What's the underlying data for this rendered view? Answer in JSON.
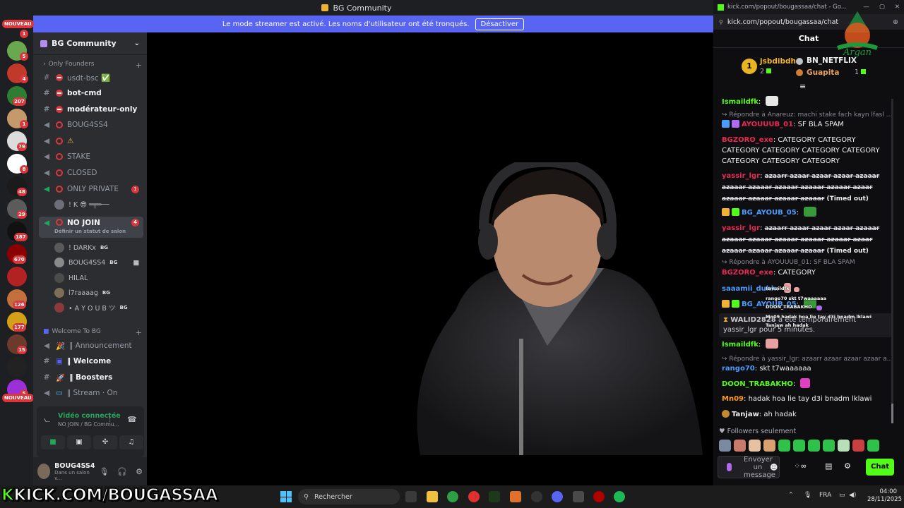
{
  "window_title": "BG Community",
  "banner": {
    "text": "Le mode streamer est activé. Les noms d'utilisateur ont été tronqués.",
    "button": "Désactiver"
  },
  "rail": {
    "new_top": "NOUVEAU",
    "new_bottom": "NOUVEAU",
    "badges": [
      "1",
      "5",
      "4",
      "207",
      "1",
      "79",
      "8",
      "48",
      "29",
      "187",
      "670",
      "126",
      "177",
      "15",
      "5"
    ]
  },
  "guild": {
    "name": "BG Community"
  },
  "categories": {
    "founders": "Only Founders",
    "welcome": "Welcome To BG"
  },
  "channels": [
    {
      "label": "usdt-bsc ✅"
    },
    {
      "label": "bot-cmd"
    },
    {
      "label": "modérateur-only"
    },
    {
      "label": "BOUG4SS4"
    },
    {
      "label": "⚠"
    },
    {
      "label": "STAKE"
    },
    {
      "label": "CLOSED"
    },
    {
      "label": "ONLY PRIVATE",
      "badge": "1"
    },
    {
      "label": "! K 😎 ═╤═──"
    },
    {
      "label": "NO JOIN",
      "badge": "4",
      "sub": "Définir un statut de salon"
    }
  ],
  "members": [
    {
      "name": "! DARKx",
      "tag": "BG"
    },
    {
      "name": "BOUG4SS4",
      "tag": "BG"
    },
    {
      "name": "HILAL",
      "tag": ""
    },
    {
      "name": "l7raaaag",
      "tag": "BG"
    },
    {
      "name": "• A Y O U B ツ",
      "tag": "BG"
    }
  ],
  "welcome_channels": [
    {
      "label": "‖ Announcement"
    },
    {
      "label": "‖ Welcome"
    },
    {
      "label": "‖ Boosters"
    },
    {
      "label": "‖ Stream · On"
    }
  ],
  "voice": {
    "status": "Vidéo connectée",
    "location": "NO JOIN / BG Commu..."
  },
  "user": {
    "name": "BOUG4SS4",
    "status": "Dans un salon v..."
  },
  "chat": {
    "window_title": "kick.com/popout/bougassaa/chat - Go...",
    "url": "kick.com/popout/bougassaa/chat",
    "header": "Chat",
    "leaderboard": [
      {
        "rank": "1",
        "name": "jsbdibdh",
        "count": "2"
      },
      {
        "rank": "",
        "name": "BN_NETFLIX",
        "count": ""
      },
      {
        "rank": "",
        "name": "Guapita",
        "count": "1"
      }
    ],
    "messages": [
      {
        "user": "Ismaildfk",
        "text": "",
        "color": "#53fc18"
      },
      {
        "reply": "Répondre à Anareuz: machi stake fach kayn lfasl ..."
      },
      {
        "user": "AYOUUUB_01",
        "text": "SF BLA SPAM",
        "color": "#e62a54"
      },
      {
        "user": "BGZORO_exe",
        "text": "CATEGORY CATEGORY CATEGORY CATEGORY CATEGORY CATEGORY CATEGORY CATEGORY CATEGORY",
        "color": "#e62a54"
      },
      {
        "user": "yassir_lgr",
        "text": "azaarr azaar azaar azaar azaaar azaaar azaaar azaaar azaaar azaaar azaar azaaar azaaar azaaar azaaar",
        "suffix": "(Timed out)",
        "color": "#e62a54"
      },
      {
        "user": "BG_AYOUB_05",
        "text": "",
        "color": "#4b9cff"
      },
      {
        "user": "yassir_lgr",
        "text": "azaarr azaar azaar azaar azaaar azaaar azaaar azaaar azaaar azaaar azaar azaaar azaaar azaaar azaaar",
        "suffix": "(Timed out)",
        "color": "#e62a54"
      },
      {
        "reply": "Répondre à AYOUUUB_01: SF BLA SPAM"
      },
      {
        "user": "BGZORO_exe",
        "text": "CATEGORY",
        "color": "#e62a54"
      },
      {
        "user": "saaamii_duhh",
        "text": "",
        "color": "#4b9cff"
      },
      {
        "user": "BG_AYOUB_05",
        "text": "",
        "color": "#4b9cff"
      },
      {
        "timeout_user": "WALID2828",
        "timeout_text": "a été temporairement yassir_lgr pour 5 minutes."
      },
      {
        "user": "Ismaildfk",
        "text": "",
        "color": "#53fc18"
      },
      {
        "reply": "Répondre à yassir_lgr: azaarr azaar azaar azaar a..."
      },
      {
        "user": "rango70",
        "text": "skt t7waaaaaa",
        "color": "#4b9cff"
      },
      {
        "user": "DOON_TRABAKHO",
        "text": "",
        "color": "#53fc18"
      },
      {
        "user": "Mn09",
        "text": "hadak hoa lie tay d3i bnadm lklawi",
        "color": "#ff9a1f"
      },
      {
        "user": "Tanjaw",
        "text": "ah hadak",
        "color": "#efeff1"
      }
    ],
    "overlay": [
      {
        "user": "Ismaildfk",
        "text": ""
      },
      {
        "user": "rango70",
        "text": "skt t7waaaaaa"
      },
      {
        "user": "DOON_TRABAKHO",
        "text": ""
      },
      {
        "user": "Mn09",
        "text": "hadak hoa lie tay d3i bnadm lklawi"
      },
      {
        "user": "Tanjaw",
        "text": "ah hadak"
      }
    ],
    "followers_only": "Followers seulement",
    "input_placeholder": "Envoyer un message",
    "send": "Chat",
    "watermark": "Argan"
  },
  "taskbar": {
    "brand_k": "K",
    "brand_rest": "KICK.COM/BOUGASSAA",
    "search": "Rechercher",
    "lang": "FRA",
    "time": "04:00",
    "date": "28/11/2025"
  },
  "colors": {
    "discord_blurple": "#5865f2",
    "kick_green": "#53fc18",
    "danger": "#da373c",
    "online": "#23a55a"
  }
}
